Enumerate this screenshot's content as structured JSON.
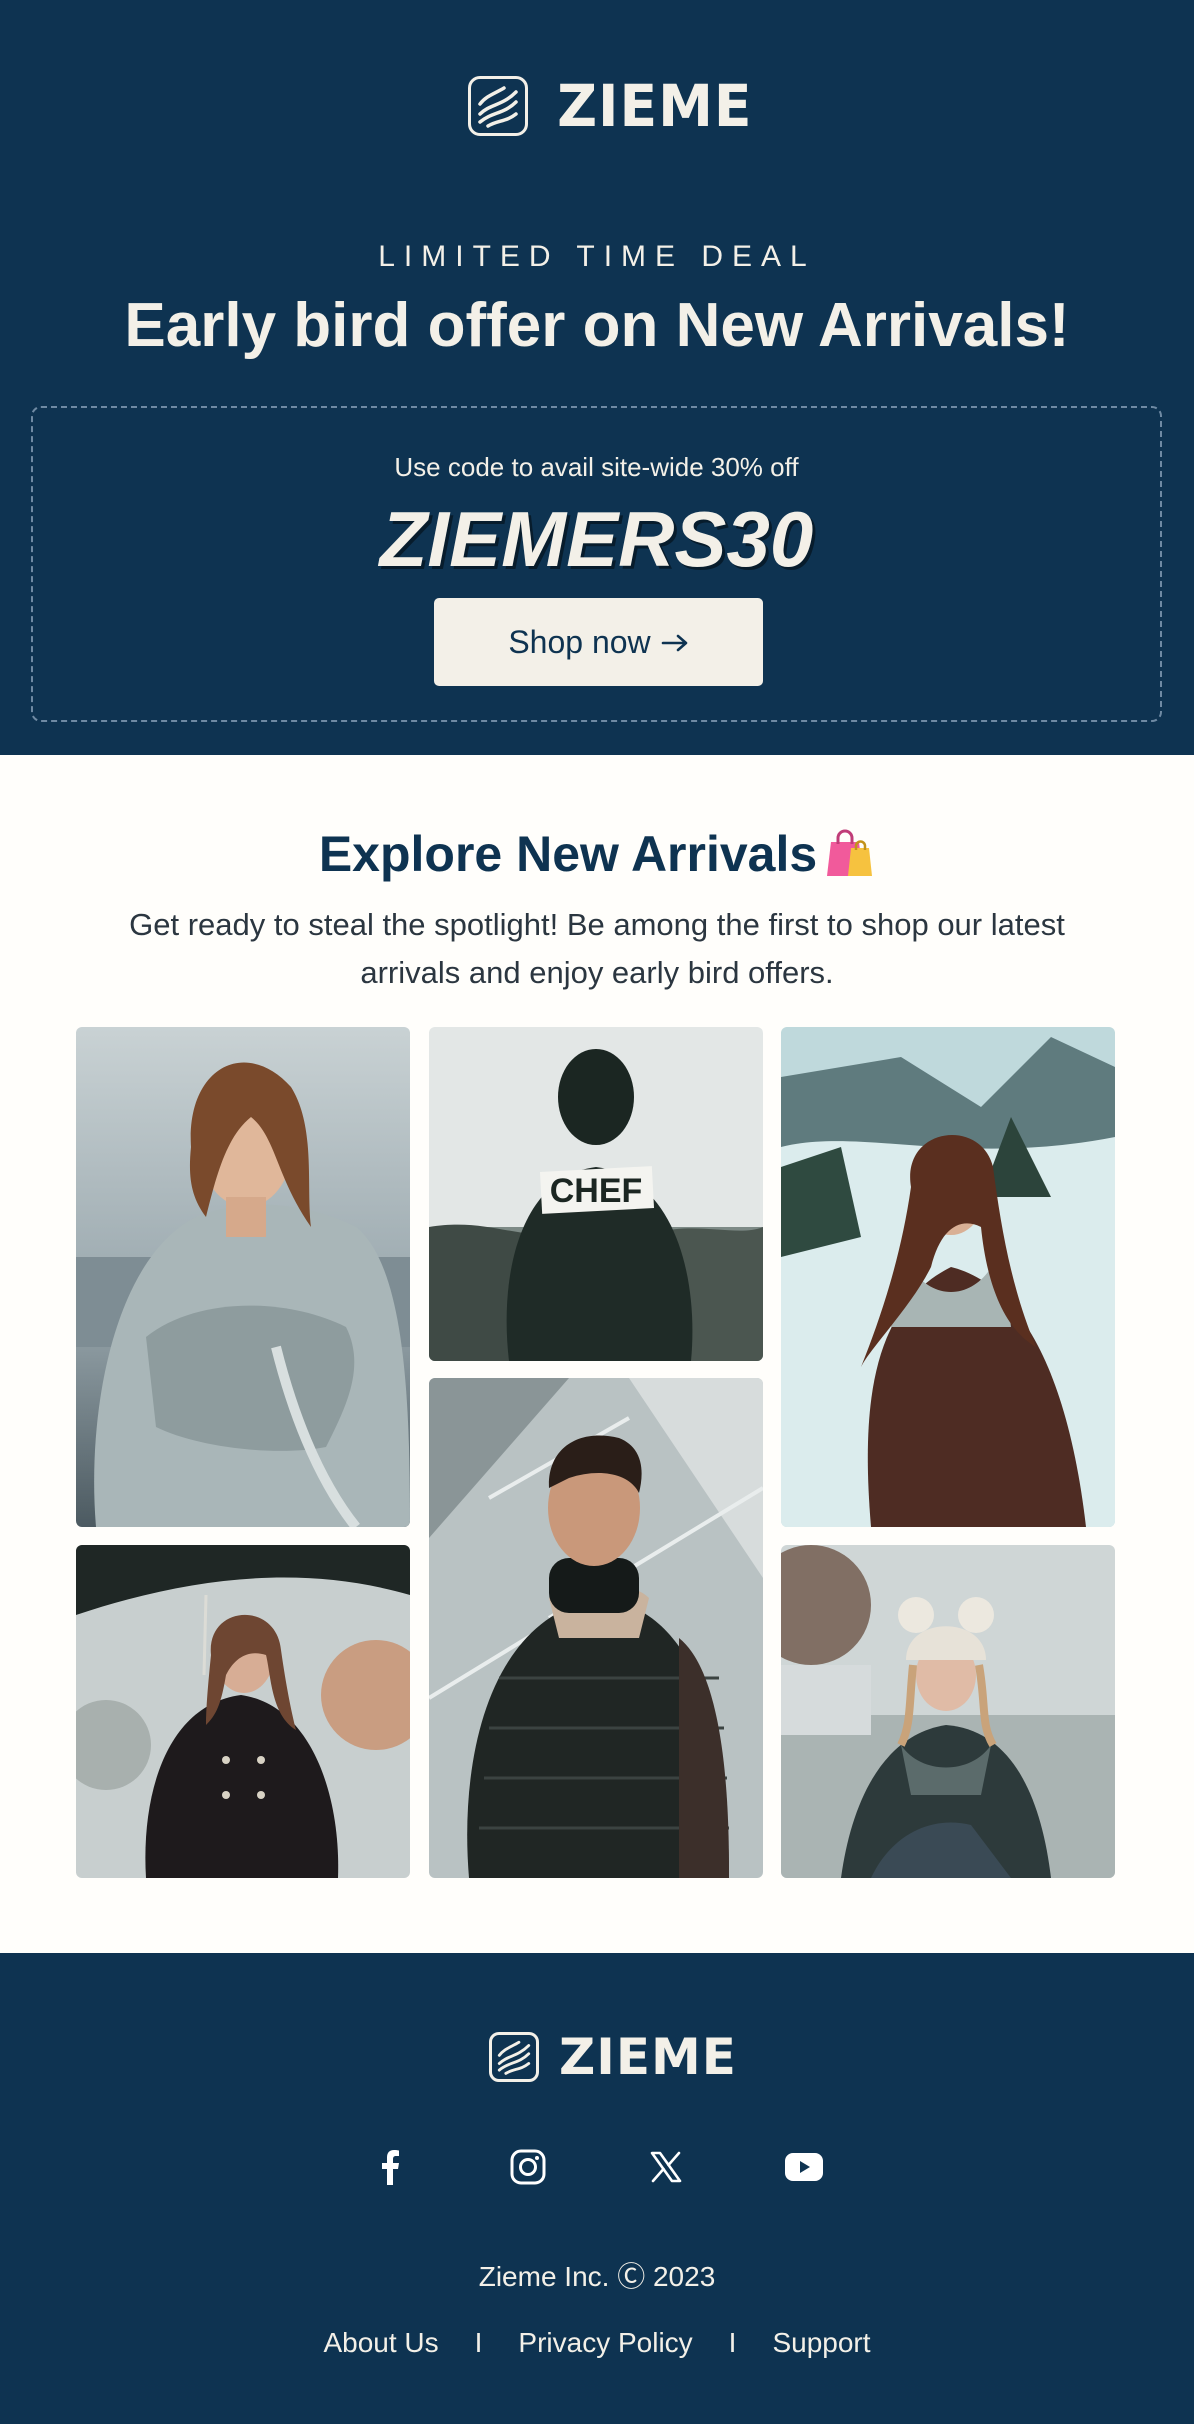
{
  "brand": {
    "name": "ZIEME",
    "accent": "#0e3351",
    "cream": "#f3f0e8"
  },
  "hero": {
    "eyebrow": "LIMITED TIME DEAL",
    "headline": "Early bird offer on New Arrivals!",
    "coupon_note": "Use code to avail site-wide 30% off",
    "coupon_code": "ZIEMERS30",
    "cta_label": "Shop now",
    "cta_icon": "arrow-right-icon"
  },
  "explore": {
    "title": "Explore New Arrivals",
    "title_icon": "shopping-bags-icon",
    "body": "Get ready to steal the spotlight! Be among the first to shop our latest arrivals and enjoy early bird offers.",
    "photos": [
      {
        "name": "woman-grey-puffer-photo"
      },
      {
        "name": "man-chef-hoodie-photo"
      },
      {
        "name": "woman-brown-coat-snow-photo"
      },
      {
        "name": "man-black-puffer-photo"
      },
      {
        "name": "woman-umbrella-black-coat-photo"
      },
      {
        "name": "woman-pompom-hat-photo"
      }
    ],
    "photo_text": "CHEF"
  },
  "footer": {
    "brand": "ZIEME",
    "social": [
      "facebook-icon",
      "instagram-icon",
      "x-icon",
      "youtube-icon"
    ],
    "copyright": "Zieme Inc. Ⓒ 2023",
    "links": [
      "About Us",
      "Privacy Policy",
      "Support"
    ],
    "separator": "I"
  }
}
